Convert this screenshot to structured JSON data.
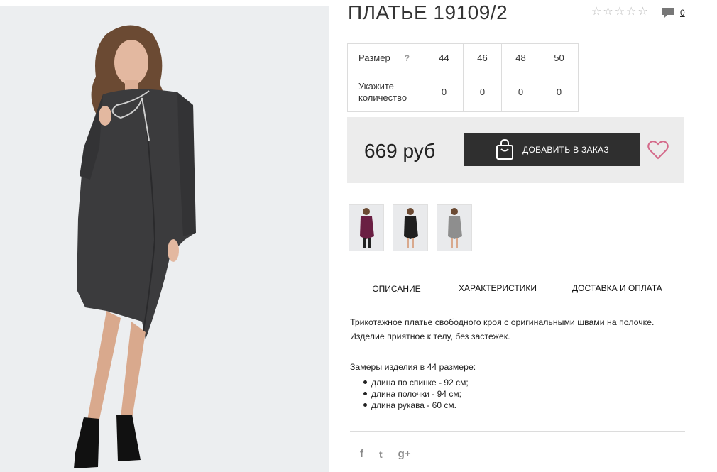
{
  "product": {
    "title": "ПЛАТЬЕ 19109/2",
    "rating_icons": [
      "star-empty",
      "star-empty",
      "star-empty",
      "star-empty",
      "star-empty"
    ],
    "comments_count": "0"
  },
  "sizes": {
    "size_label": "Размер",
    "help_glyph": "?",
    "qty_label_line1": "Укажите",
    "qty_label_line2": "количество",
    "items": [
      {
        "size": "44",
        "qty": "0"
      },
      {
        "size": "46",
        "qty": "0"
      },
      {
        "size": "48",
        "qty": "0"
      },
      {
        "size": "50",
        "qty": "0"
      }
    ]
  },
  "purchase": {
    "price": "669 руб",
    "add_button_label": "ДОБАВИТЬ В ЗАКАЗ"
  },
  "thumbnails": [
    {
      "color": "#6a1f43"
    },
    {
      "color": "#1f1f1f"
    },
    {
      "color": "#8e8e8e"
    }
  ],
  "tabs": {
    "description": "ОПИСАНИЕ",
    "characteristics": "ХАРАКТЕРИСТИКИ",
    "delivery": "ДОСТАВКА И ОПЛАТА"
  },
  "description": {
    "line1": "Трикотажное платье свободного кроя с оригинальными швами на полочке.",
    "line2": "Изделие приятное к телу, без застежек.",
    "measure_title": "Замеры изделия в 44 размере:",
    "measures": [
      "длина по спинке - 92 см;",
      "длина полочки - 94 см;",
      "длина рукава - 60 см."
    ]
  },
  "social": {
    "facebook": "f",
    "twitter": "t",
    "googleplus": "g+"
  },
  "colors": {
    "button_bg": "#2f2f2f",
    "heart": "#d46a8a",
    "price_box_bg": "#ececec"
  }
}
